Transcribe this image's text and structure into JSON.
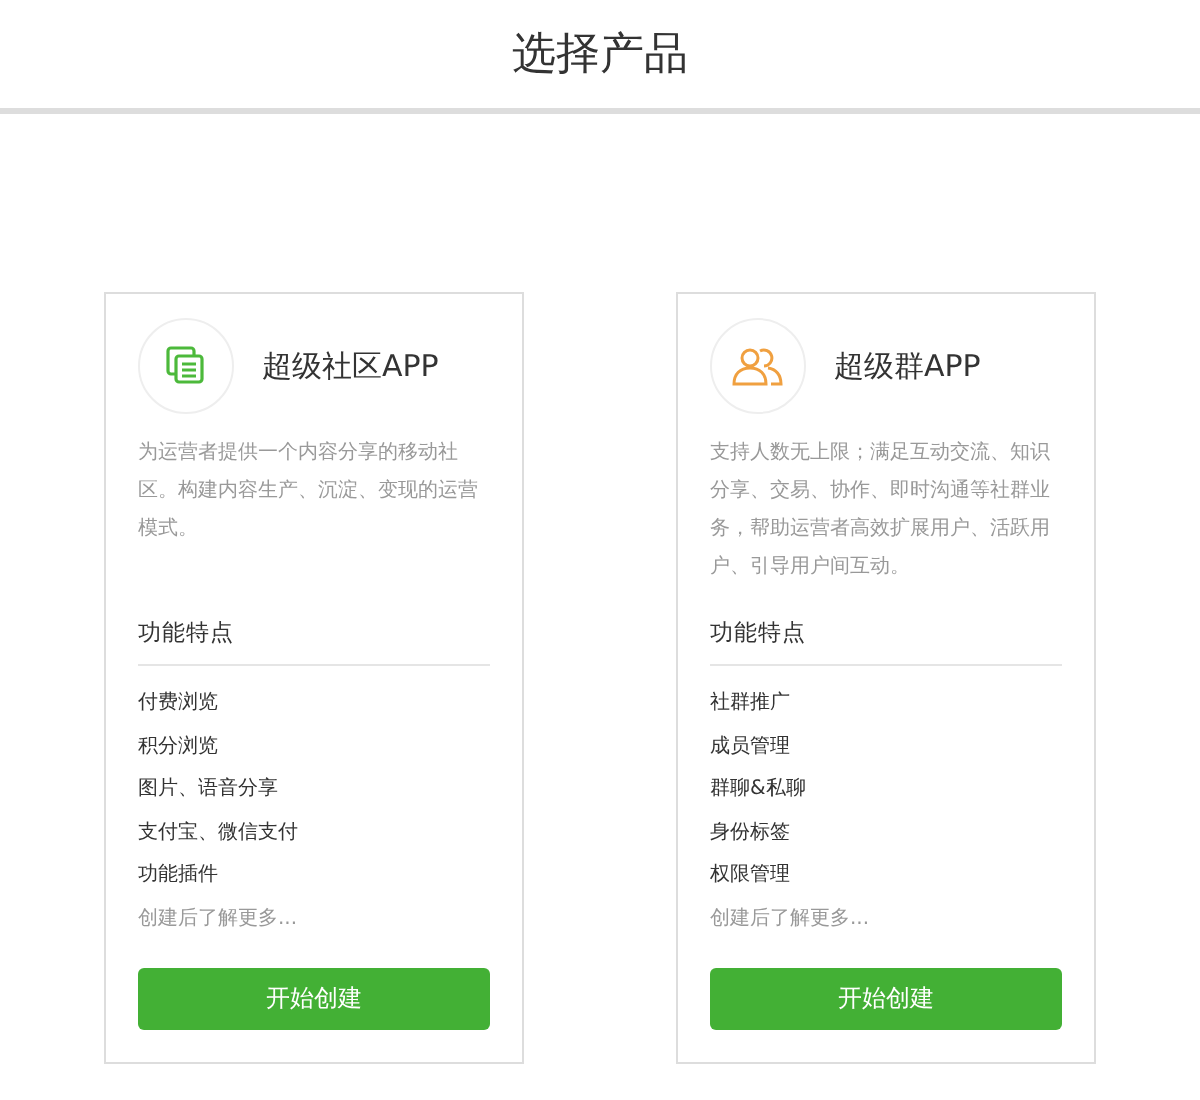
{
  "header": {
    "title": "选择产品"
  },
  "products": [
    {
      "kind": "document",
      "name": "超级社区APP",
      "description": "为运营者提供一个内容分享的移动社区。构建内容生产、沉淀、变现的运营模式。",
      "features_heading": "功能特点",
      "features": [
        "付费浏览",
        "积分浏览",
        "图片、语音分享",
        "支付宝、微信支付",
        "功能插件"
      ],
      "more": "创建后了解更多...",
      "button": "开始创建"
    },
    {
      "kind": "people",
      "name": "超级群APP",
      "description": "支持人数无上限；满足互动交流、知识分享、交易、协作、即时沟通等社群业务，帮助运营者高效扩展用户、活跃用户、引导用户间互动。",
      "features_heading": "功能特点",
      "features": [
        "社群推广",
        "成员管理",
        "群聊&私聊",
        "身份标签",
        "权限管理"
      ],
      "more": "创建后了解更多...",
      "button": "开始创建"
    }
  ]
}
